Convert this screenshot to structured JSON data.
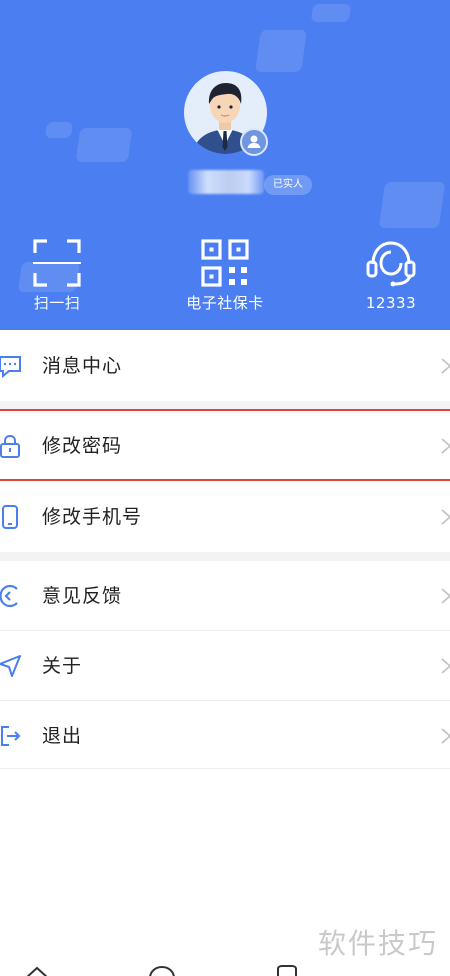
{
  "profile": {
    "verified_tag": "已实人"
  },
  "quick_actions": [
    {
      "label": "扫一扫",
      "icon": "scan-icon"
    },
    {
      "label": "电子社保卡",
      "icon": "qr-code-icon"
    },
    {
      "label": "12333",
      "icon": "headset-icon"
    }
  ],
  "menu": {
    "message_center": "消息中心",
    "change_password": "修改密码",
    "change_phone": "修改手机号",
    "feedback": "意见反馈",
    "about": "关于",
    "logout": "退出"
  },
  "watermark": "软件技巧",
  "colors": {
    "header_bg": "#4a7ef1",
    "icon_accent": "#4a7ef1",
    "highlight_border": "#e0453c"
  }
}
